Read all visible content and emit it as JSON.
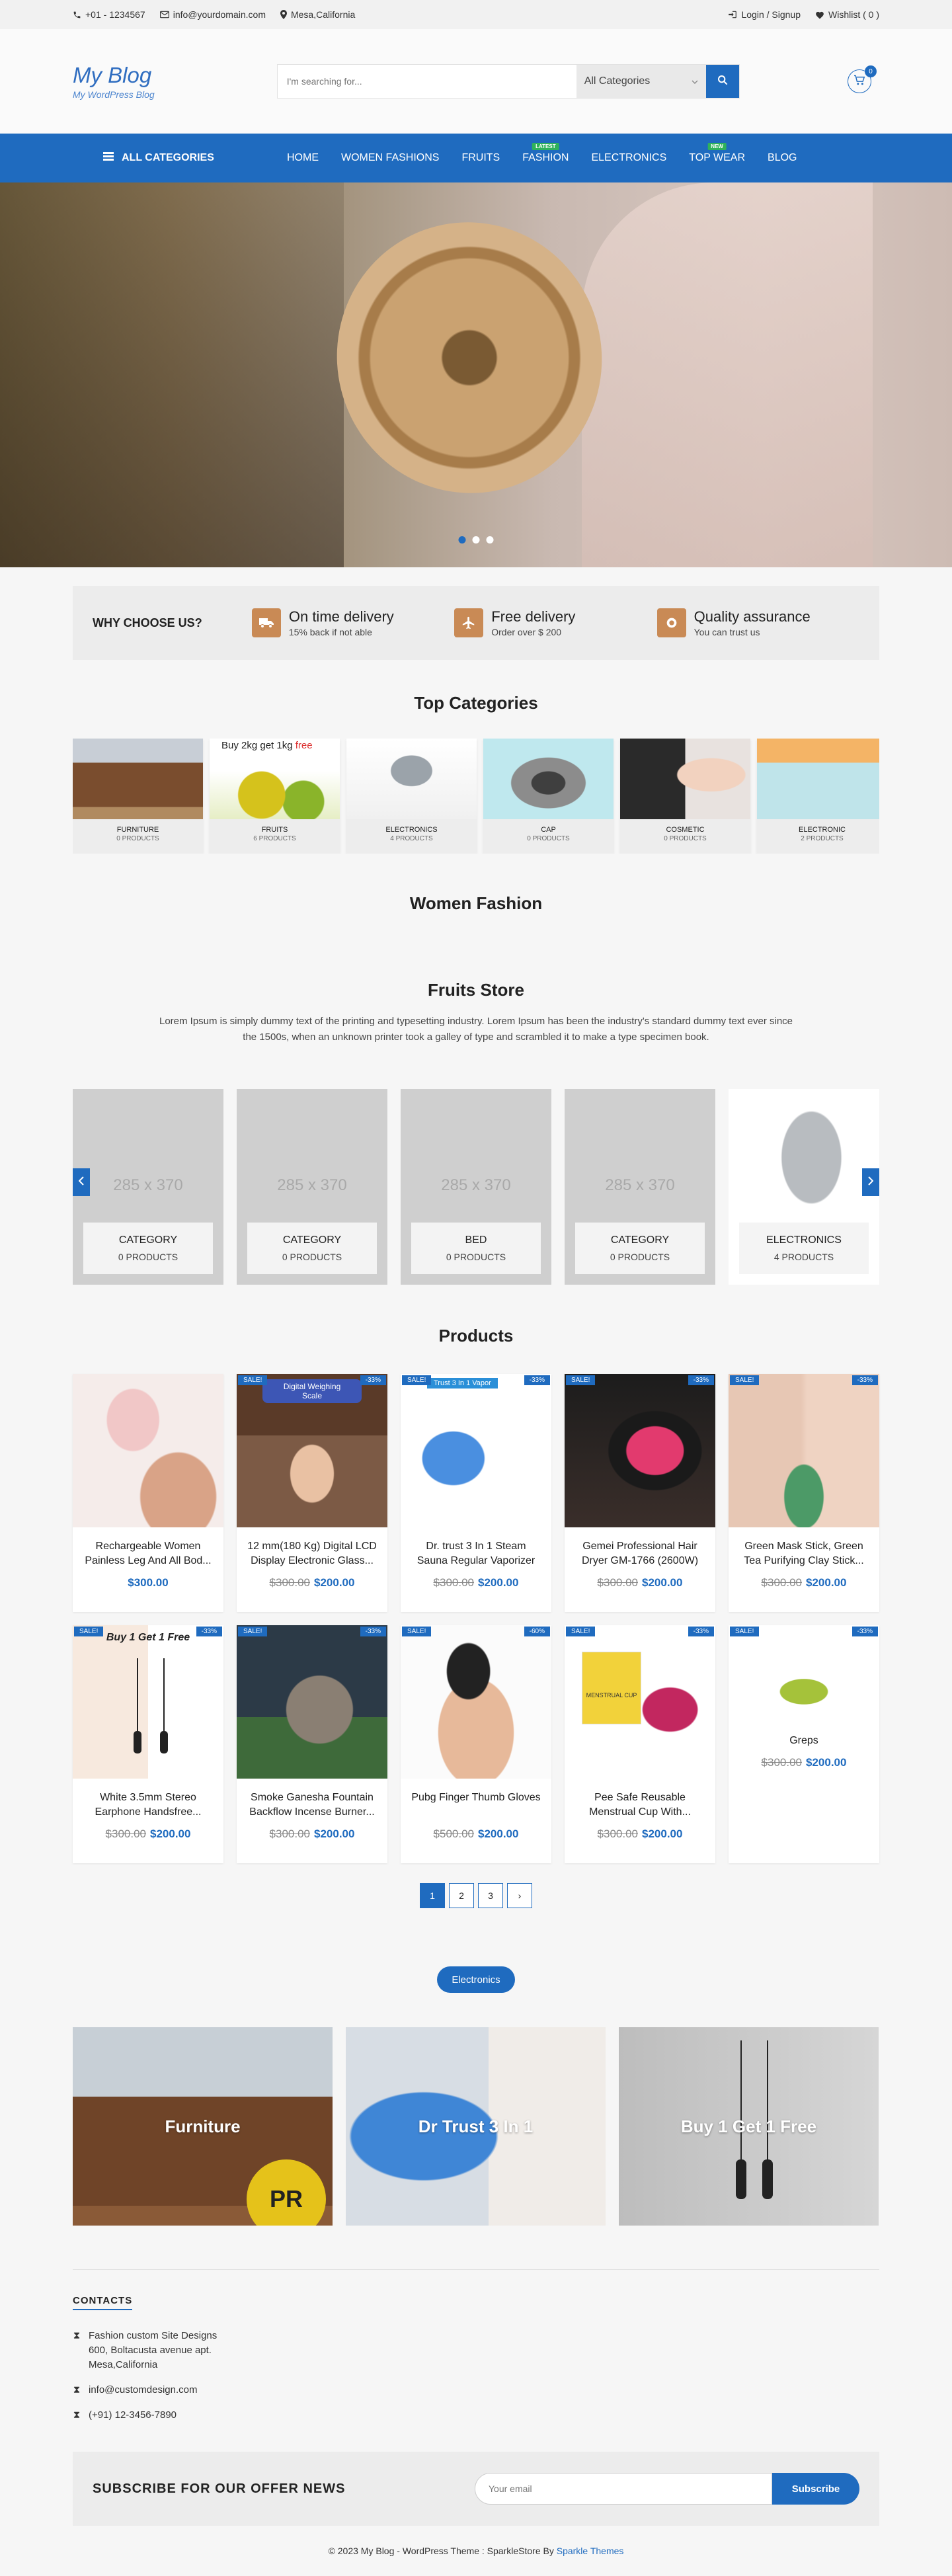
{
  "topbar": {
    "phone": "+01 - 1234567",
    "email": "info@yourdomain.com",
    "location": "Mesa,California",
    "login": "Login / Signup",
    "wishlist": "Wishlist ( 0 )"
  },
  "header": {
    "logo_title": "My Blog",
    "logo_subtitle": "My WordPress Blog",
    "search_placeholder": "I'm searching for...",
    "category_select": "All Categories",
    "cart_count": "0"
  },
  "nav": {
    "all_categories": "ALL CATEGORIES",
    "items": [
      {
        "label": "HOME",
        "tag": ""
      },
      {
        "label": "WOMEN FASHIONS",
        "tag": ""
      },
      {
        "label": "FRUITS",
        "tag": ""
      },
      {
        "label": "FASHION",
        "tag": "LATEST"
      },
      {
        "label": "ELECTRONICS",
        "tag": ""
      },
      {
        "label": "TOP WEAR",
        "tag": "NEW"
      },
      {
        "label": "BLOG",
        "tag": ""
      }
    ]
  },
  "why": {
    "title": "WHY CHOOSE US?",
    "features": [
      {
        "title": "On time delivery",
        "sub": "15% back if not able",
        "icon": "truck-icon"
      },
      {
        "title": "Free delivery",
        "sub": "Order over $ 200",
        "icon": "plane-icon"
      },
      {
        "title": "Quality assurance",
        "sub": "You can trust us",
        "icon": "badge-icon"
      }
    ]
  },
  "top_categories": {
    "title": "Top Categories",
    "items": [
      {
        "name": "FURNITURE",
        "count": "0 PRODUCTS",
        "overlay": ""
      },
      {
        "name": "FRUITS",
        "count": "6 PRODUCTS",
        "overlay": "Buy 2kg get 1kg",
        "overlay_accent": "free"
      },
      {
        "name": "ELECTRONICS",
        "count": "4 PRODUCTS",
        "overlay": ""
      },
      {
        "name": "CAP",
        "count": "0 PRODUCTS",
        "overlay": ""
      },
      {
        "name": "COSMETIC",
        "count": "0 PRODUCTS",
        "overlay": ""
      },
      {
        "name": "ELECTRONIC",
        "count": "2 PRODUCTS",
        "overlay": ""
      }
    ]
  },
  "women_fashion": {
    "title": "Women Fashion"
  },
  "fruits_store": {
    "title": "Fruits Store",
    "description": "Lorem Ipsum is simply dummy text of the printing and typesetting industry. Lorem Ipsum has been the industry's standard dummy text ever since the 1500s, when an unknown printer took a galley of type and scrambled it to make a type specimen book.",
    "items": [
      {
        "size": "285 x 370",
        "name": "CATEGORY",
        "count": "0 PRODUCTS"
      },
      {
        "size": "285 x 370",
        "name": "CATEGORY",
        "count": "0 PRODUCTS"
      },
      {
        "size": "285 x 370",
        "name": "BED",
        "count": "0 PRODUCTS"
      },
      {
        "size": "285 x 370",
        "name": "CATEGORY",
        "count": "0 PRODUCTS"
      },
      {
        "size": "",
        "name": "ELECTRONICS",
        "count": "4 PRODUCTS"
      }
    ]
  },
  "products": {
    "title": "Products",
    "items": [
      {
        "name": "Rechargeable Women Painless Leg And All Bod...",
        "old": "",
        "price": "$300.00",
        "sale": "",
        "off": ""
      },
      {
        "name": "12 mm(180 Kg) Digital LCD Display Electronic Glass...",
        "old": "$300.00",
        "price": "$200.00",
        "sale": "SALE!",
        "off": "-33%"
      },
      {
        "name": "Dr. trust 3 In 1 Steam Sauna Regular Vaporizer",
        "old": "$300.00",
        "price": "$200.00",
        "sale": "SALE!",
        "off": "-33%"
      },
      {
        "name": "Gemei Professional Hair Dryer GM-1766 (2600W)",
        "old": "$300.00",
        "price": "$200.00",
        "sale": "SALE!",
        "off": "-33%"
      },
      {
        "name": "Green Mask Stick, Green Tea Purifying Clay Stick...",
        "old": "$300.00",
        "price": "$200.00",
        "sale": "SALE!",
        "off": "-33%"
      },
      {
        "name": "White 3.5mm Stereo Earphone Handsfree...",
        "old": "$300.00",
        "price": "$200.00",
        "sale": "SALE!",
        "off": "-33%"
      },
      {
        "name": "Smoke Ganesha Fountain Backflow Incense Burner...",
        "old": "$300.00",
        "price": "$200.00",
        "sale": "SALE!",
        "off": "-33%"
      },
      {
        "name": "Pubg Finger Thumb Gloves",
        "old": "$500.00",
        "price": "$200.00",
        "sale": "SALE!",
        "off": "-60%"
      },
      {
        "name": "Pee Safe Reusable Menstrual Cup With...",
        "old": "$300.00",
        "price": "$200.00",
        "sale": "SALE!",
        "off": "-33%"
      },
      {
        "name": "Greps",
        "old": "$300.00",
        "price": "$200.00",
        "sale": "SALE!",
        "off": "-33%"
      }
    ],
    "img_text": {
      "scale": "Digital Weighing Scale",
      "vapor": "Trust 3 In 1 Vapor",
      "earphone": "Buy 1 Get 1 Free",
      "cup": "MENSTRUAL CUP"
    },
    "pages": [
      "1",
      "2",
      "3",
      "›"
    ]
  },
  "electronics_pill": "Electronics",
  "banners": [
    {
      "title": "Furniture",
      "stamp": "PR"
    },
    {
      "title": "Dr Trust 3 In 1"
    },
    {
      "title": "Buy 1 Get 1 Free"
    }
  ],
  "contacts": {
    "title": "CONTACTS",
    "address": [
      "Fashion custom Site Designs",
      "600, Boltacusta avenue apt.",
      "Mesa,California"
    ],
    "email": "info@customdesign.com",
    "phone": "(+91) 12-3456-7890"
  },
  "subscribe": {
    "title": "SUBSCRIBE FOR OUR OFFER NEWS",
    "placeholder": "Your email",
    "button": "Subscribe"
  },
  "footer": {
    "text": "© 2023 My Blog - WordPress Theme : SparkleStore By ",
    "link": "Sparkle Themes"
  },
  "colors": {
    "primary": "#1f6bbf",
    "accent_tag": "#2fb25b"
  }
}
